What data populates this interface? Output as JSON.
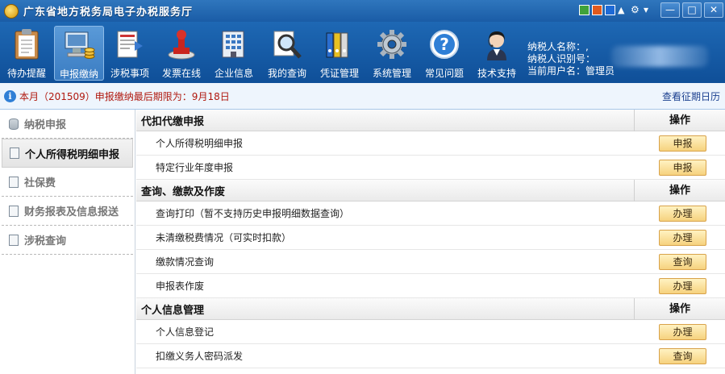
{
  "window": {
    "title": "广东省地方税务局电子办税服务厅"
  },
  "toolbar": {
    "items": [
      {
        "label": "待办提醒",
        "icon": "clipboard-icon"
      },
      {
        "label": "申报缴纳",
        "icon": "computer-coins-icon",
        "active": true
      },
      {
        "label": "涉税事项",
        "icon": "form-arrow-icon"
      },
      {
        "label": "发票在线",
        "icon": "stamp-icon"
      },
      {
        "label": "企业信息",
        "icon": "building-icon"
      },
      {
        "label": "我的查询",
        "icon": "magnifier-icon"
      },
      {
        "label": "凭证管理",
        "icon": "binders-icon"
      },
      {
        "label": "系统管理",
        "icon": "gear-icon"
      },
      {
        "label": "常见问题",
        "icon": "question-icon"
      },
      {
        "label": "技术支持",
        "icon": "support-agent-icon"
      }
    ]
  },
  "user_info": {
    "taxpayer_name_label": "纳税人名称：,",
    "taxpayer_id_label": "纳税人识别号：",
    "current_user": "当前用户名：管理员"
  },
  "notice": {
    "text": "本月（201509）申报缴纳最后期限为：9月18日",
    "link": "查看征期日历"
  },
  "sidebar": {
    "items": [
      {
        "label": "纳税申报"
      },
      {
        "label": "个人所得税明细申报",
        "active": true
      },
      {
        "label": "社保费"
      },
      {
        "label": "财务报表及信息报送"
      },
      {
        "label": "涉税查询"
      }
    ]
  },
  "main": {
    "op_header": "操作",
    "sections": [
      {
        "title": "代扣代缴申报",
        "rows": [
          {
            "label": "个人所得税明细申报",
            "action": "申报"
          },
          {
            "label": "特定行业年度申报",
            "action": "申报"
          }
        ]
      },
      {
        "title": "查询、缴款及作废",
        "rows": [
          {
            "label": "查询打印（暂不支持历史申报明细数据查询）",
            "action": "办理"
          },
          {
            "label": "未清缴税费情况（可实时扣款）",
            "action": "办理"
          },
          {
            "label": "缴款情况查询",
            "action": "查询"
          },
          {
            "label": "申报表作废",
            "action": "办理"
          }
        ]
      },
      {
        "title": "个人信息管理",
        "rows": [
          {
            "label": "个人信息登记",
            "action": "办理"
          },
          {
            "label": "扣缴义务人密码派发",
            "action": "查询"
          }
        ]
      }
    ]
  },
  "colors": {
    "toolbar_blue": "#1a5ca6",
    "notice_red": "#b0180e",
    "button_gold": "#f6d27e"
  }
}
